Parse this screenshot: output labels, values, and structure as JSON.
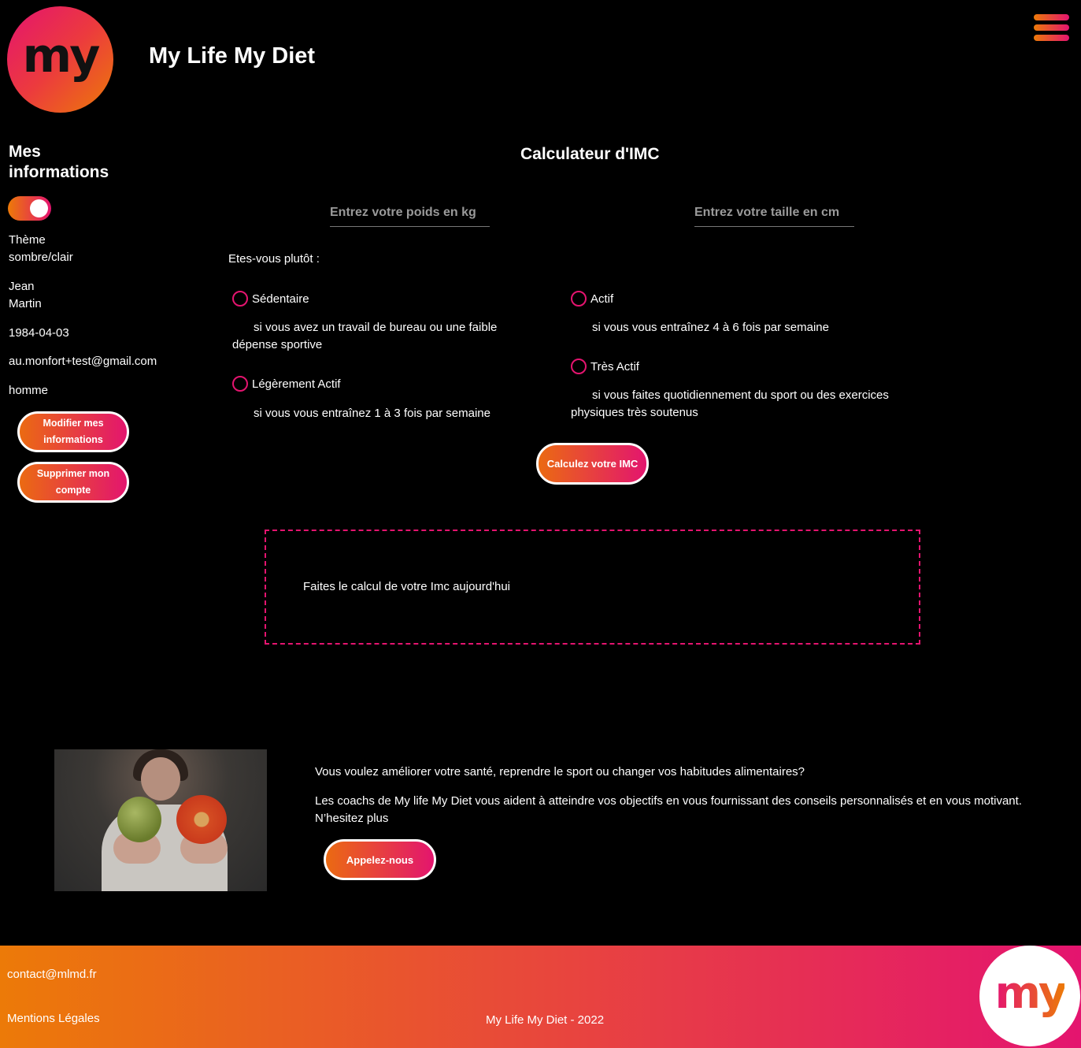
{
  "header": {
    "logo_text": "my",
    "site_title": "My Life My Diet"
  },
  "sidebar": {
    "title": "Mes informations",
    "theme_toggle_on": true,
    "theme_label": "Thème sombre/clair",
    "first_name": "Jean",
    "last_name": "Martin",
    "birthdate": "1984-04-03",
    "email": "au.monfort+test@gmail.com",
    "gender": "homme",
    "edit_button": "Modifier mes informations",
    "delete_button": "Supprimer mon compte"
  },
  "calculator": {
    "title": "Calculateur d'IMC",
    "weight_placeholder": "Entrez votre poids en kg",
    "height_placeholder": "Entrez votre taille en cm",
    "question": "Etes-vous plutôt :",
    "options": [
      {
        "label": "Sédentaire",
        "description": "si vous avez un travail de bureau ou une faible dépense sportive"
      },
      {
        "label": "Légèrement Actif",
        "description": "si vous vous entraînez 1 à 3 fois par semaine"
      },
      {
        "label": "Actif",
        "description": "si vous vous entraînez 4 à 6 fois par semaine"
      },
      {
        "label": "Très Actif",
        "description": "si vous faites quotidiennement du sport ou des exercices physiques très soutenus"
      }
    ],
    "submit_button": "Calculez votre IMC",
    "result_text": "Faites le calcul de votre Imc aujourd'hui"
  },
  "promo": {
    "paragraph1": "Vous voulez améliorer votre santé, reprendre le sport ou changer vos habitudes alimentaires?",
    "paragraph2": "Les coachs de My life My Diet vous aident à atteindre vos objectifs en vous fournissant des conseils personnalisés et en vous motivant. N’hesitez plus",
    "call_button": "Appelez-nous"
  },
  "footer": {
    "contact": "contact@mlmd.fr",
    "legal": "Mentions Légales",
    "copyright": "My Life My Diet - 2022",
    "logo_text": "my"
  },
  "colors": {
    "accent_orange": "#ec7a08",
    "accent_pink": "#e4146f",
    "background": "#000000"
  }
}
